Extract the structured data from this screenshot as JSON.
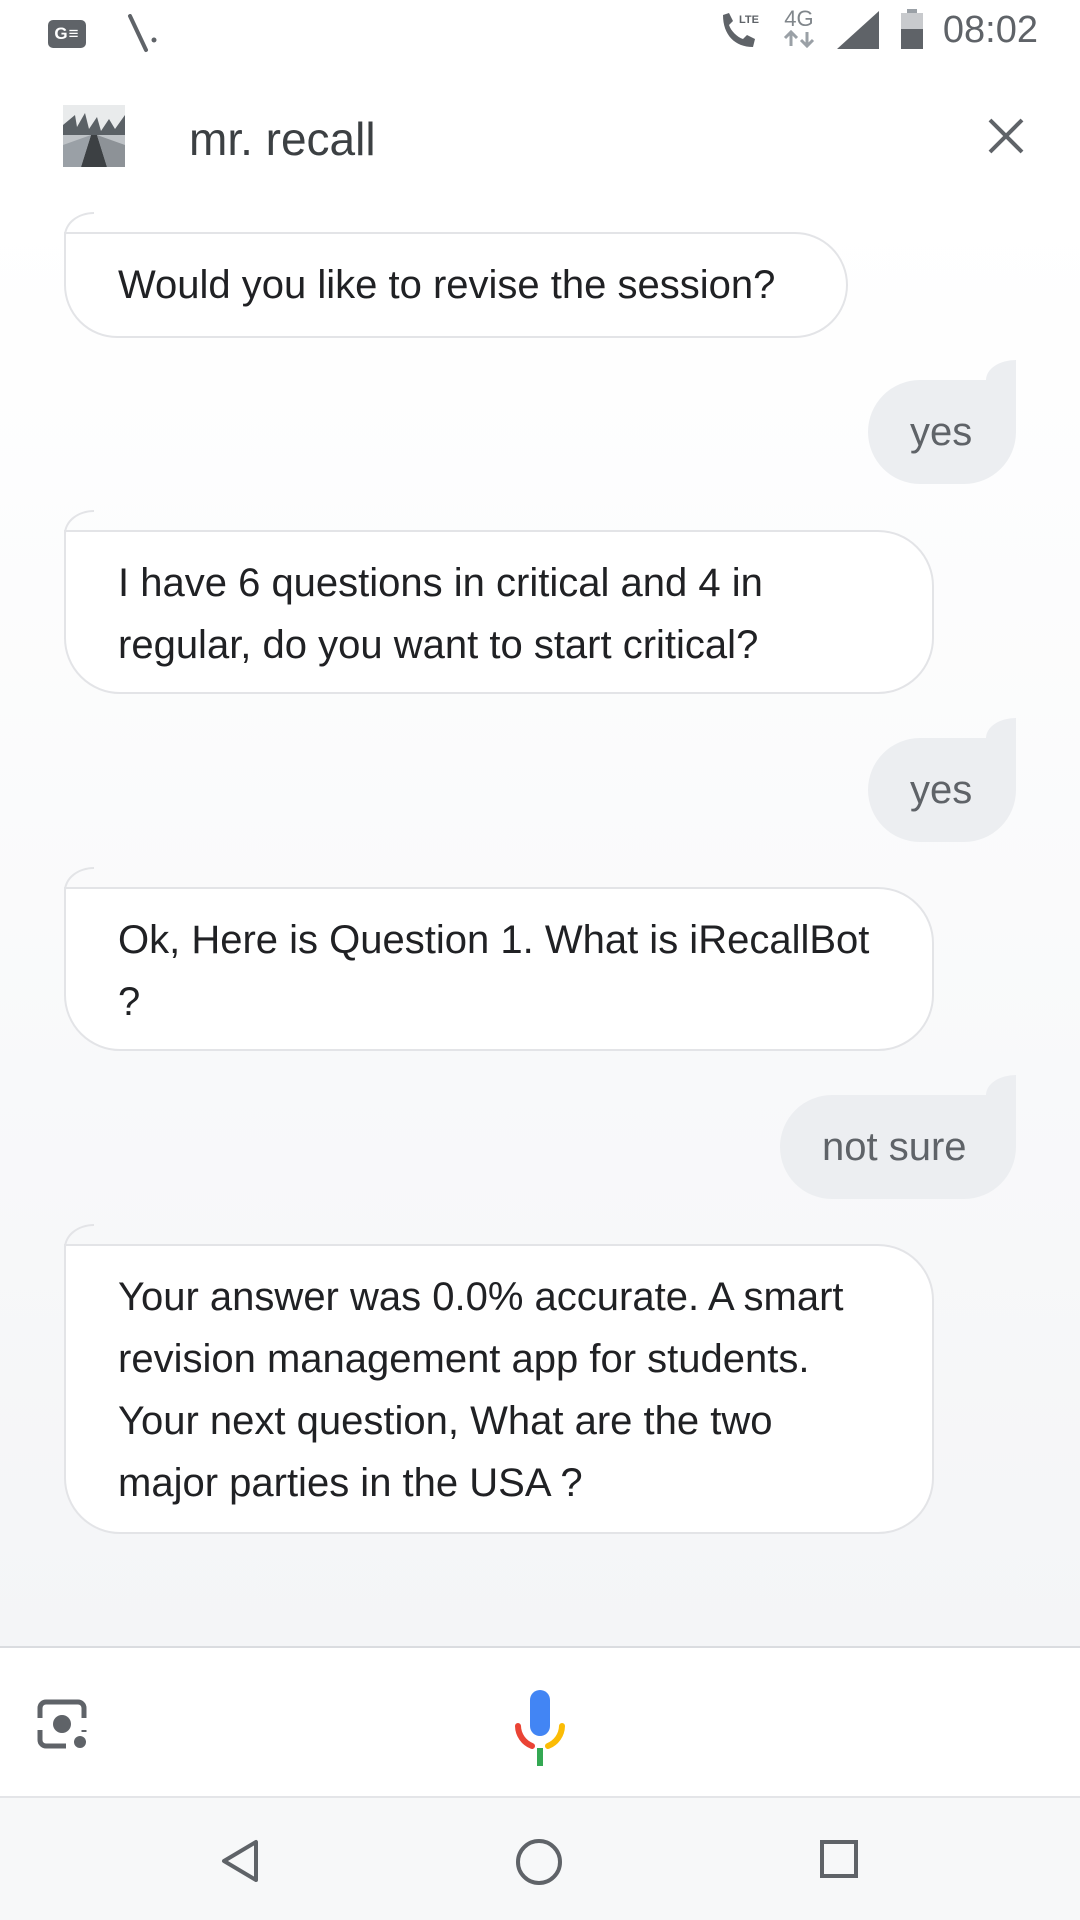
{
  "status_bar": {
    "ge_badge": "G≡",
    "network_4g": "4G",
    "lte": "LTE",
    "time": "08:02"
  },
  "header": {
    "title": "mr. recall"
  },
  "messages": [
    {
      "role": "bot",
      "text": "Would you like to revise the session?"
    },
    {
      "role": "user",
      "text": "yes"
    },
    {
      "role": "bot",
      "text": " I have 6 questions in critical and 4 in regular, do you want to start critical?"
    },
    {
      "role": "user",
      "text": "yes"
    },
    {
      "role": "bot",
      "text": "Ok, Here is Question 1.  What is iRecallBot ?"
    },
    {
      "role": "user",
      "text": "not sure"
    },
    {
      "role": "bot",
      "text": "Your answer was 0.0% accurate. A smart revision management app for students. Your next question,  What are the two major parties in the USA ?"
    }
  ],
  "icons": {
    "close": "close-icon",
    "lens": "lens-icon",
    "mic": "mic-icon",
    "back": "back-icon",
    "home": "home-icon",
    "recents": "recents-icon"
  },
  "colors": {
    "mic_blue": "#4285f4",
    "mic_red": "#ea4335",
    "mic_yellow": "#fbbc05",
    "mic_green": "#34a853"
  }
}
